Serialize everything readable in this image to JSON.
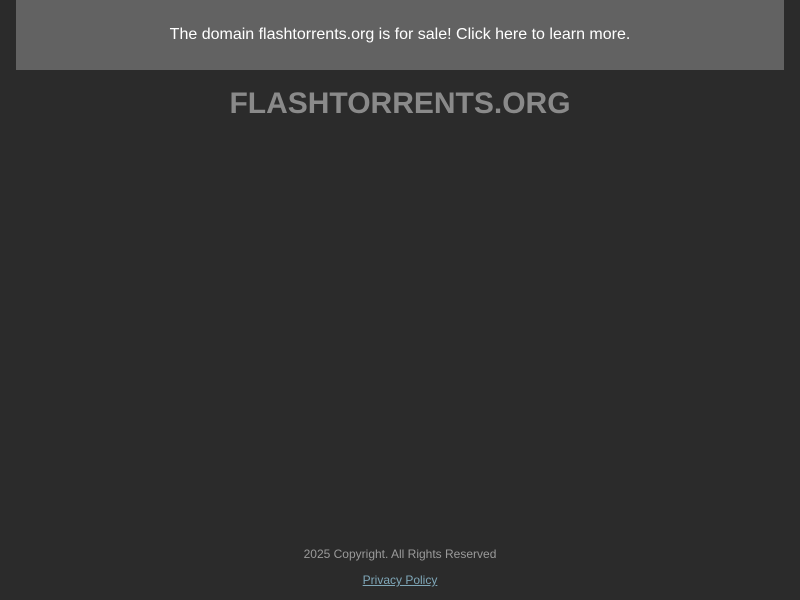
{
  "banner": {
    "text": "The domain flashtorrents.org is for sale! Click here to learn more."
  },
  "header": {
    "title": "FLASHTORRENTS.ORG"
  },
  "footer": {
    "copyright": "2025 Copyright. All Rights Reserved",
    "privacy_label": "Privacy Policy"
  },
  "colors": {
    "background": "#2b2b2b",
    "banner_background": "#626262",
    "title": "#8a8a8a",
    "link": "#7fa7b8"
  }
}
